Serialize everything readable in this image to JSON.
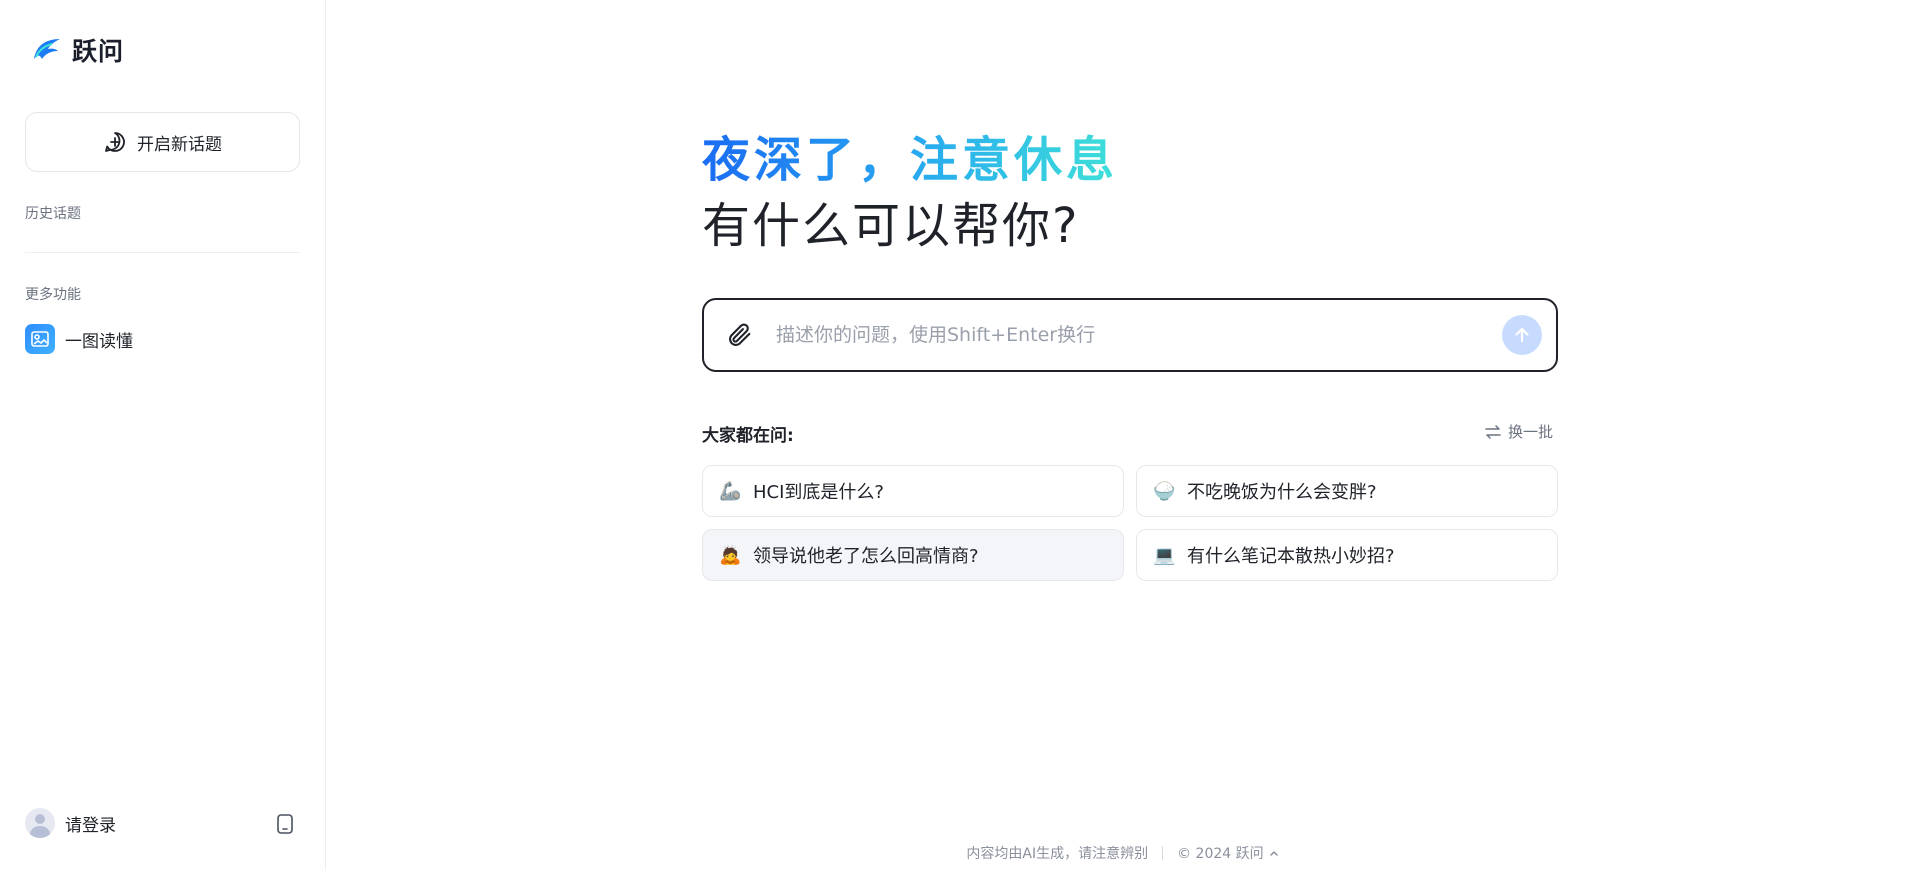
{
  "app": {
    "name": "跃问"
  },
  "sidebar": {
    "new_topic_label": "开启新话题",
    "history_label": "历史话题",
    "more_features_label": "更多功能",
    "features": [
      {
        "label": "一图读懂",
        "icon": "image-read-icon"
      }
    ],
    "login_label": "请登录"
  },
  "main": {
    "greeting": "夜深了，注意休息",
    "question": "有什么可以帮你?",
    "input": {
      "placeholder": "描述你的问题，使用Shift+Enter换行",
      "value": ""
    },
    "popular": {
      "title": "大家都在问:",
      "refresh_label": "换一批",
      "items": [
        {
          "icon": "🦾",
          "label": "HCI到底是什么?"
        },
        {
          "icon": "🍚",
          "label": "不吃晚饭为什么会变胖?"
        },
        {
          "icon": "🙇",
          "label": "领导说他老了怎么回高情商?"
        },
        {
          "icon": "💻",
          "label": "有什么笔记本散热小妙招?"
        }
      ]
    }
  },
  "footer": {
    "disclaimer": "内容均由AI生成，请注意辨别",
    "copyright": "© 2024 跃问"
  },
  "colors": {
    "accent": "#1b6cf2",
    "gradient_end": "#3ee0d8",
    "send_button": "#c7dbff"
  }
}
